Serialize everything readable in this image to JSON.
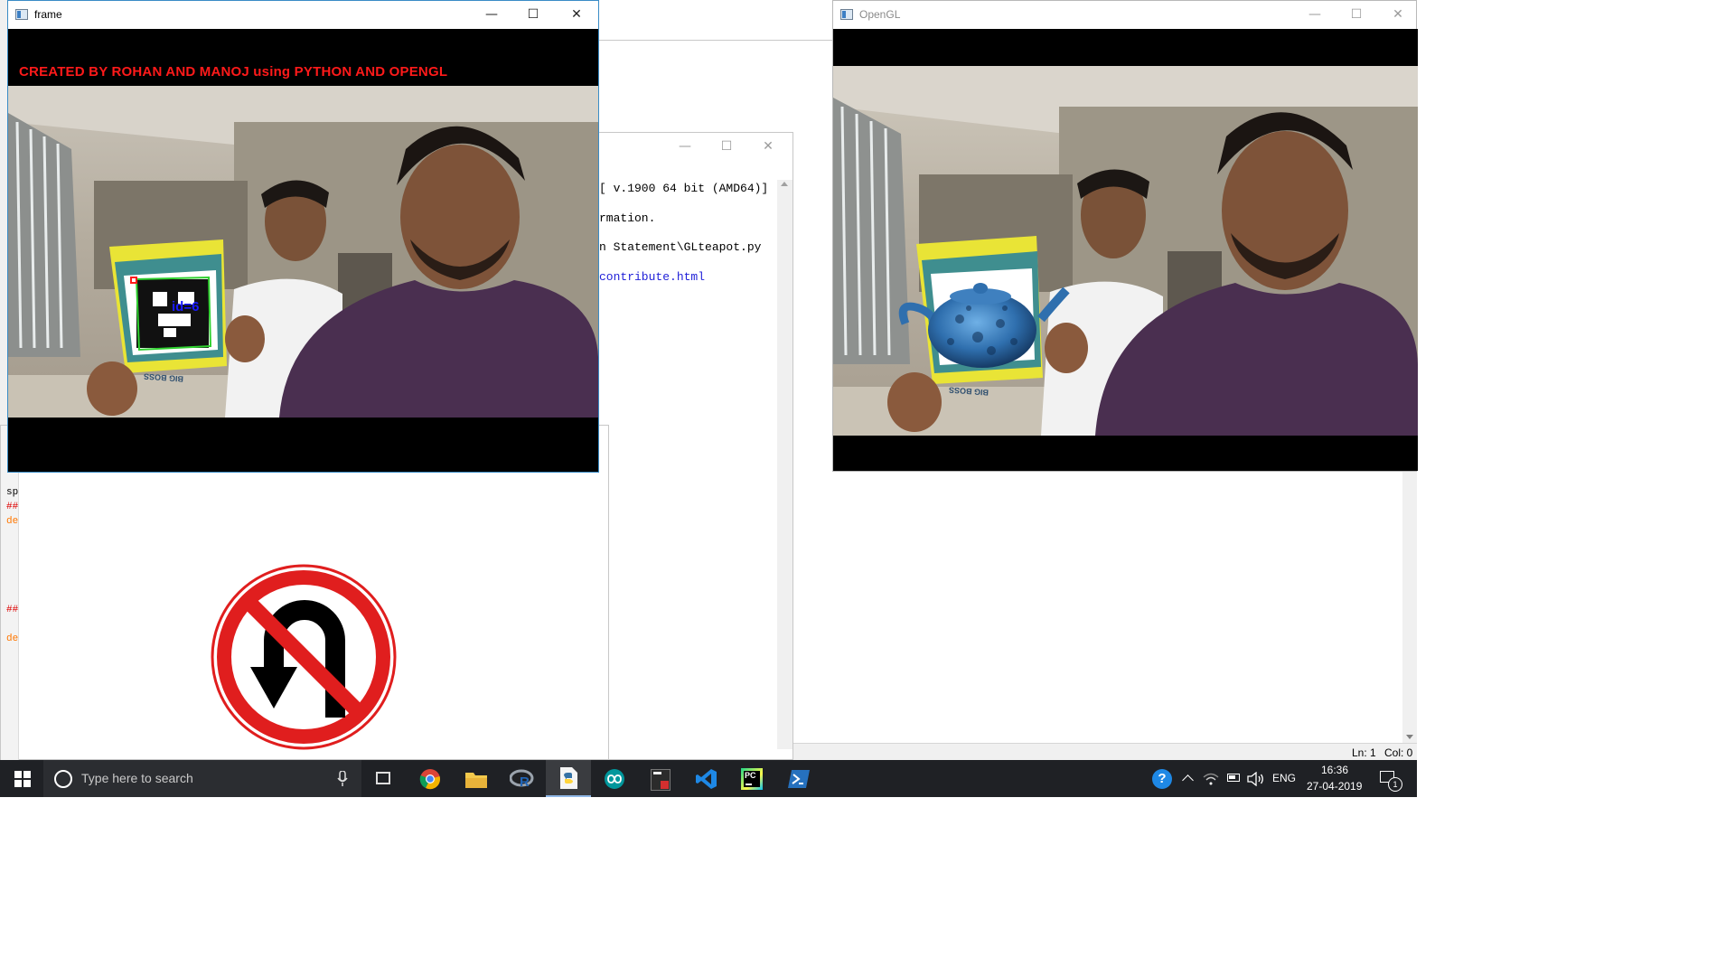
{
  "frame_window": {
    "title": "frame",
    "overlay_text": "CREATED BY ROHAN AND MANOJ using PYTHON AND OPENGL",
    "marker_label": "id=6",
    "book_text": "BIG BOSS",
    "controls": {
      "minimize": "—",
      "maximize": "☐",
      "close": "✕"
    }
  },
  "opengl_window": {
    "title": "OpenGL",
    "book_text": "BIG BOSS",
    "controls": {
      "minimize": "—",
      "maximize": "☐",
      "close": "✕"
    }
  },
  "shell_window": {
    "controls": {
      "minimize": "—",
      "maximize": "☐",
      "close": "✕"
    },
    "lines": [
      "[ v.1900 64 bit (AMD64)]",
      "rmation.",
      "n Statement\\GLteapot.py",
      "contribute.html"
    ]
  },
  "editor_fragment": {
    "lines": [
      "sp",
      "##",
      "de",
      "##",
      "de"
    ]
  },
  "status_bar": {
    "line": "Ln: 1",
    "col": "Col: 0"
  },
  "taskbar": {
    "search_placeholder": "Type here to search",
    "language": "ENG",
    "time": "16:36",
    "date": "27-04-2019",
    "notification_count": "1",
    "help": "?",
    "pc_label": "PC"
  },
  "colors": {
    "overlay_red": "#ff1a1a",
    "marker_green": "#2fd12f",
    "marker_blue": "#1a1aff",
    "taskbar_bg": "#1f2125",
    "teapot_blue": "#3a7fc4"
  }
}
